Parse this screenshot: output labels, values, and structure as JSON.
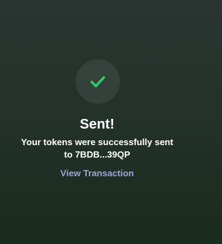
{
  "status": {
    "icon": "checkmark-icon",
    "accent_color": "#2ec866",
    "title": "Sent!",
    "message_line1": "Your tokens were successfully sent",
    "message_prefix": "to ",
    "recipient": "7BDB...39QP"
  },
  "actions": {
    "view_transaction_label": "View Transaction",
    "link_color": "#9aa6d6"
  }
}
